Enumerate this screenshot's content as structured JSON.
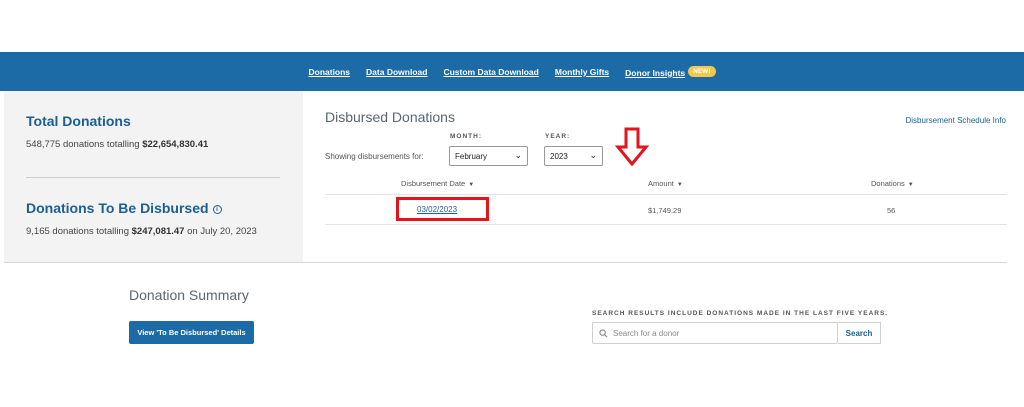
{
  "nav": {
    "items": [
      {
        "label": "Donations"
      },
      {
        "label": "Data Download"
      },
      {
        "label": "Custom Data Download"
      },
      {
        "label": "Monthly Gifts"
      },
      {
        "label": "Donor Insights"
      }
    ],
    "badge": "NEW!"
  },
  "totals": {
    "total_title": "Total Donations",
    "total_text_prefix": "548,775 donations totalling ",
    "total_amount": "$22,654,830.41",
    "disbursed_title": "Donations To Be Disbursed",
    "info_glyph": "i",
    "disbursed_text_prefix": "9,165 donations totalling ",
    "disbursed_amount": "$247,081.47",
    "disbursed_text_suffix": " on July 20, 2023"
  },
  "disbursed": {
    "title": "Disbursed Donations",
    "schedule_link": "Disbursement Schedule Info",
    "showing_label": "Showing disbursements for:",
    "month_label": "MONTH:",
    "month_value": "February",
    "year_label": "YEAR:",
    "year_value": "2023",
    "columns": [
      "Disbursement Date",
      "Amount",
      "Donations"
    ],
    "rows": [
      {
        "date": "03/02/2023",
        "amount": "$1,749.29",
        "donations": "56"
      }
    ]
  },
  "summary": {
    "title": "Donation Summary",
    "view_button": "View 'To Be Disbursed' Details",
    "search_note": "SEARCH RESULTS INCLUDE DONATIONS MADE IN THE LAST FIVE YEARS.",
    "search_placeholder": "Search for a donor",
    "search_button": "Search"
  },
  "colors": {
    "brand": "#1c6aa6",
    "link": "#1a5f94",
    "badge": "#f2c94c",
    "annotation_red": "#e4131c"
  },
  "icons": {
    "chevron": "chevron-down-icon",
    "sort": "caret-down-icon",
    "search": "search-icon",
    "info": "info-icon",
    "annotation_arrow": "arrow-down-icon"
  }
}
